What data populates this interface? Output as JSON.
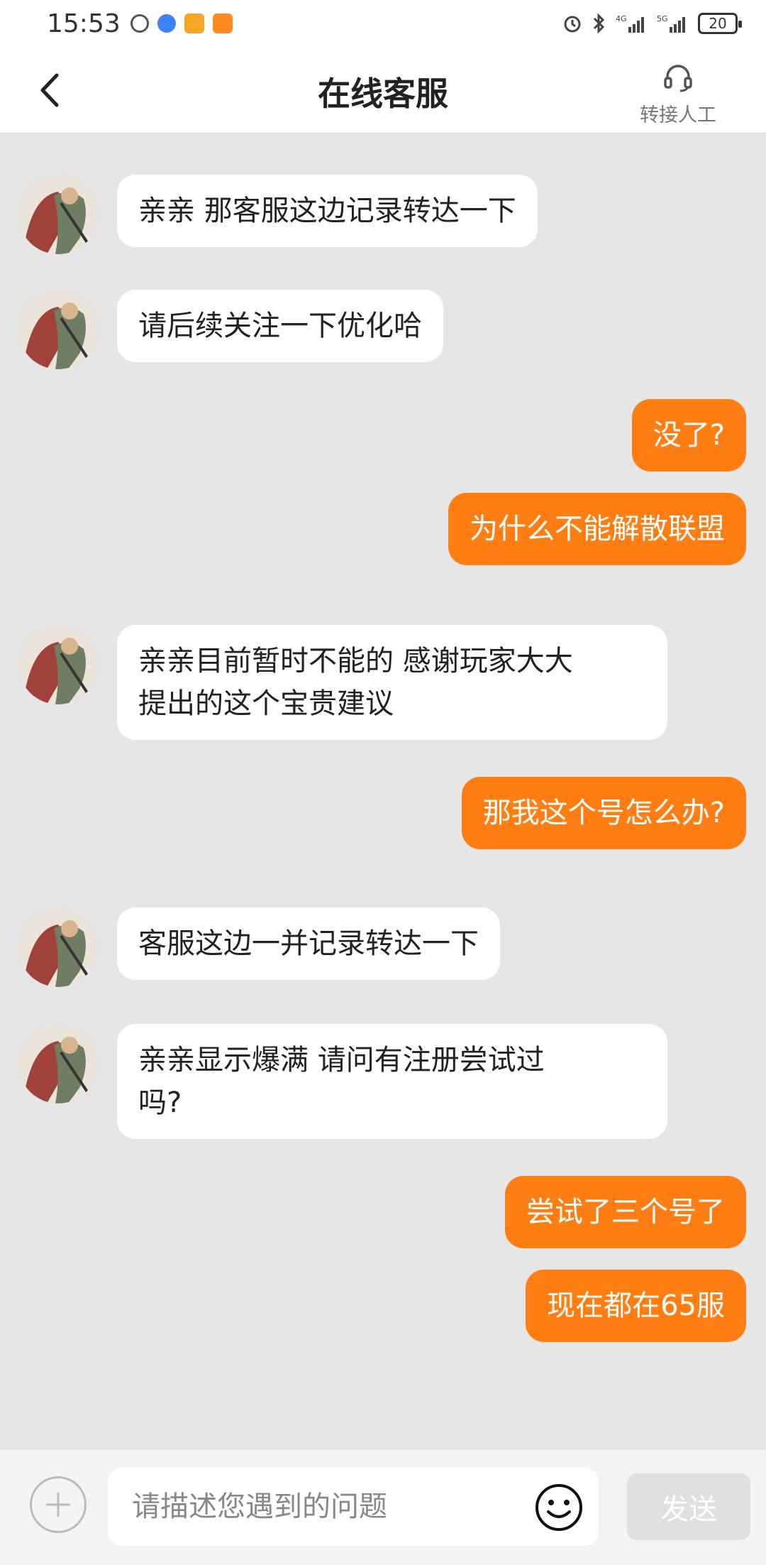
{
  "status_bar": {
    "time": "15:53",
    "battery": "20"
  },
  "header": {
    "title": "在线客服",
    "transfer_label": "转接人工"
  },
  "colors": {
    "accent": "#ff7e14",
    "background": "#e6e6e6",
    "bubble_left": "#ffffff"
  },
  "messages": [
    {
      "side": "left",
      "lines": [
        "亲亲 那客服这边记录转达一下"
      ]
    },
    {
      "side": "left",
      "lines": [
        "请后续关注一下优化哈"
      ]
    },
    {
      "side": "right",
      "lines": [
        "没了?"
      ]
    },
    {
      "side": "right",
      "lines": [
        "为什么不能解散联盟"
      ]
    },
    {
      "side": "left",
      "lines": [
        "亲亲目前暂时不能的  感谢玩家大大",
        "提出的这个宝贵建议"
      ]
    },
    {
      "side": "right",
      "lines": [
        "那我这个号怎么办?"
      ]
    },
    {
      "side": "left",
      "lines": [
        "客服这边一并记录转达一下"
      ]
    },
    {
      "side": "left",
      "lines": [
        "亲亲显示爆满  请问有注册尝试过",
        "吗?"
      ]
    },
    {
      "side": "right",
      "lines": [
        "尝试了三个号了"
      ]
    },
    {
      "side": "right",
      "lines": [
        "现在都在65服"
      ]
    }
  ],
  "input": {
    "placeholder": "请描述您遇到的问题",
    "send_label": "发送"
  }
}
